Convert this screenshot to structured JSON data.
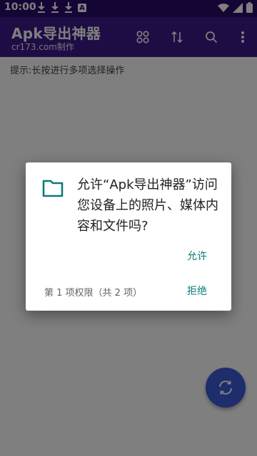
{
  "status_bar": {
    "time": "10:00",
    "icons": [
      "download-icon",
      "download-icon",
      "download-icon",
      "a-notification-icon",
      "wifi-icon",
      "signal-icon",
      "battery-icon"
    ]
  },
  "app_bar": {
    "title": "Apk导出神器",
    "subtitle": "cr173.com制作",
    "actions": [
      "grid-icon",
      "sort-icon",
      "search-icon",
      "more-vert-icon"
    ]
  },
  "hint_text": "提示:长按进行多项选择操作",
  "fab": {
    "icon": "refresh-icon"
  },
  "dialog": {
    "icon": "folder-icon",
    "message": "允许“Apk导出神器”访问您设备上的照片、媒体内容和文件吗?",
    "allow_label": "允许",
    "permission_count": "第 1 项权限（共 2 项）",
    "deny_label": "拒绝"
  },
  "colors": {
    "status_bar": "#2a0a6a",
    "app_bar": "#3d1a8a",
    "accent": "#0a7c78",
    "fab": "#3d5bd6"
  }
}
